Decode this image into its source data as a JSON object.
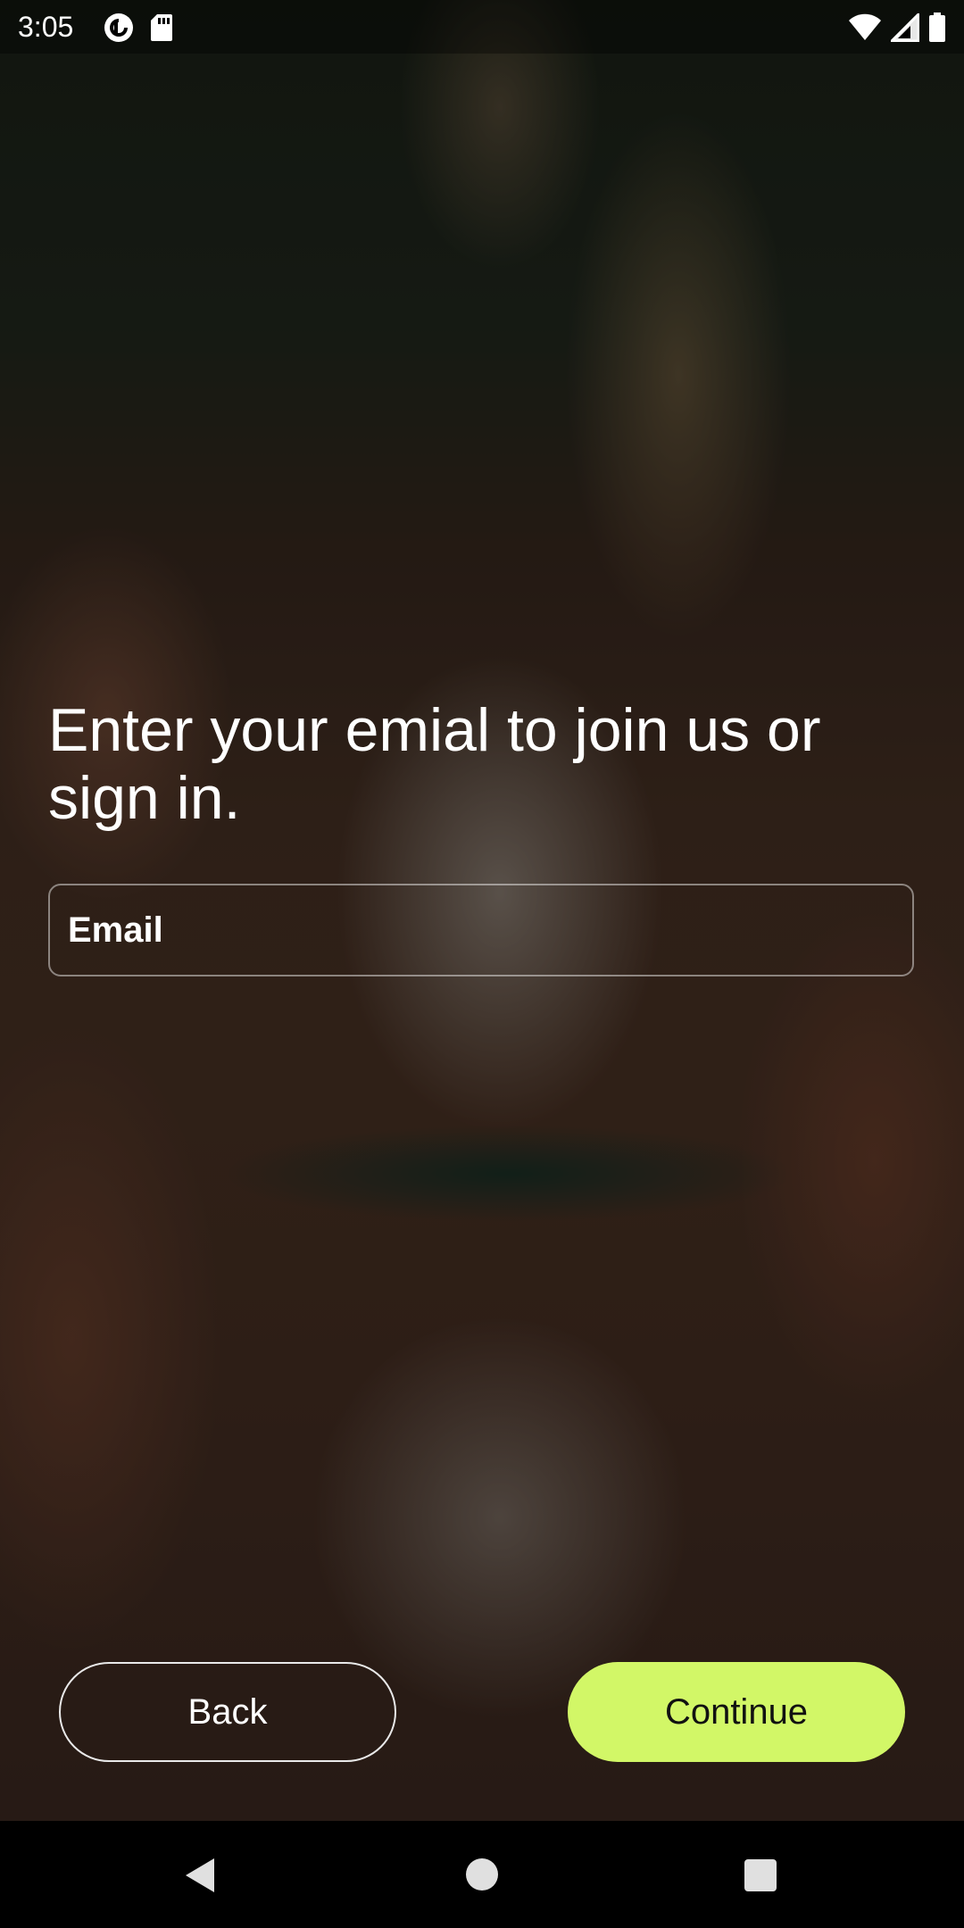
{
  "status_bar": {
    "time": "3:05",
    "left_icons": [
      "pocket-casts-icon",
      "sd-card-icon"
    ],
    "right_icons": [
      "wifi-icon",
      "cellular-signal-icon",
      "battery-icon"
    ]
  },
  "content": {
    "headline": "Enter your emial to join us or sign in.",
    "email_field": {
      "placeholder": "Email",
      "value": ""
    }
  },
  "actions": {
    "back_label": "Back",
    "continue_label": "Continue"
  },
  "colors": {
    "accent": "#d2f767",
    "text": "#ffffff",
    "nav_bar": "#000000"
  },
  "nav_bar": {
    "icons": [
      "back-triangle-icon",
      "home-circle-icon",
      "recents-square-icon"
    ]
  }
}
